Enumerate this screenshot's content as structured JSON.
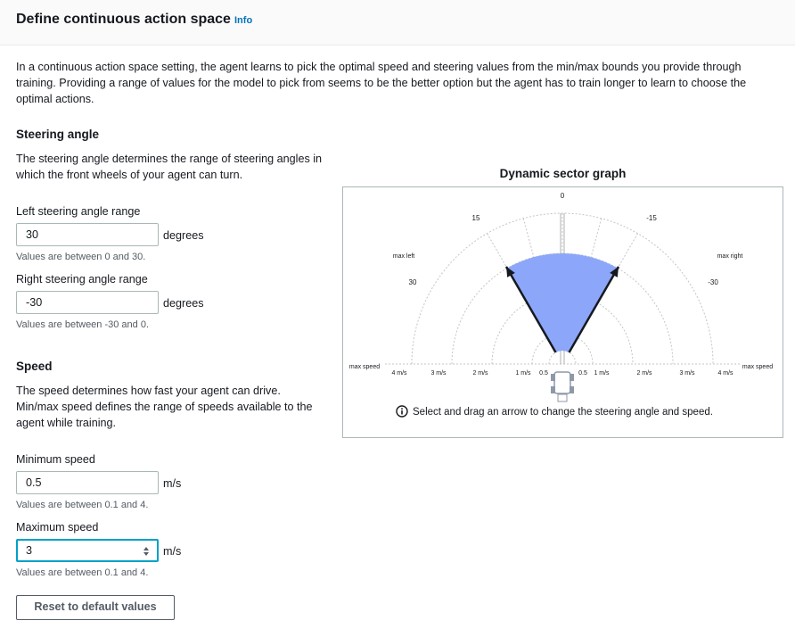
{
  "header": {
    "title": "Define continuous action space",
    "info_link": "Info"
  },
  "description": "In a continuous action space setting, the agent learns to pick the optimal speed and steering values from the min/max bounds you provide through training. Providing a range of values for the model to pick from seems to be the better option but the agent has to train longer to learn to choose the optimal actions.",
  "steering": {
    "heading": "Steering angle",
    "description": "The steering angle determines the range of steering angles in which the front wheels of your agent can turn.",
    "left": {
      "label": "Left steering angle range",
      "value": "30",
      "unit": "degrees",
      "hint": "Values are between 0 and 30."
    },
    "right": {
      "label": "Right steering angle range",
      "value": "-30",
      "unit": "degrees",
      "hint": "Values are between -30 and 0."
    }
  },
  "speed": {
    "heading": "Speed",
    "description": "The speed determines how fast your agent can drive. Min/max speed defines the range of speeds available to the agent while training.",
    "min": {
      "label": "Minimum speed",
      "value": "0.5",
      "unit": "m/s",
      "hint": "Values are between 0.1 and 4."
    },
    "max": {
      "label": "Maximum speed",
      "value": "3",
      "unit": "m/s",
      "hint": "Values are between 0.1 and 4."
    }
  },
  "reset_button": "Reset to default values",
  "graph": {
    "title": "Dynamic sector graph",
    "angle_labels": {
      "zero": "0",
      "left_15": "15",
      "right_15": "-15",
      "left_30": "30",
      "right_30": "-30"
    },
    "max_left_label": "max left",
    "max_right_label": "max right",
    "max_speed_label": "max speed",
    "left_speed_ticks": [
      "4 m/s",
      "3 m/s",
      "2 m/s",
      "1 m/s",
      "0.5"
    ],
    "right_speed_ticks": [
      "0.5",
      "1 m/s",
      "2 m/s",
      "3 m/s",
      "4 m/s"
    ],
    "hint": "Select and drag an arrow to change the steering angle and speed.",
    "sector": {
      "min_speed": 0.5,
      "max_speed": 3,
      "left_angle": 30,
      "right_angle": -30,
      "color": "#8ca6f9"
    }
  }
}
